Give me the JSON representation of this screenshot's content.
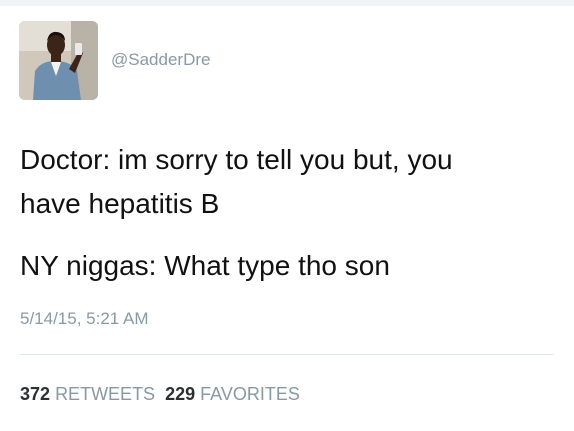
{
  "tweet": {
    "handle": "@SadderDre",
    "lines": [
      "Doctor: im sorry to tell you but, you",
      "have hepatitis B",
      "NY niggas: What type tho son"
    ],
    "timestamp": "5/14/15, 5:21 AM"
  },
  "stats": {
    "retweets_count": "372",
    "retweets_label": "RETWEETS",
    "favorites_count": "229",
    "favorites_label": "FAVORITES"
  },
  "avatar": {
    "icon": "user-avatar-photo"
  }
}
